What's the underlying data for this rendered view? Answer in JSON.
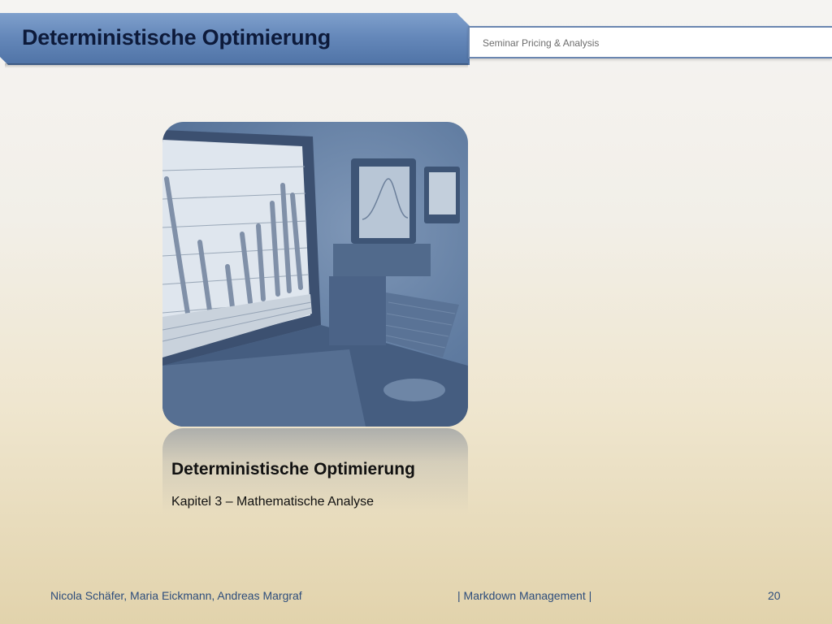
{
  "header": {
    "title": "Deterministische Optimierung",
    "subtitle": "Seminar Pricing & Analysis"
  },
  "card": {
    "image_alt": "computer-monitors-with-bar-chart-photo",
    "heading": "Deterministische Optimierung",
    "subheading": "Kapitel 3 – Mathematische Analyse"
  },
  "footer": {
    "authors": "Nicola Schäfer, Maria Eickmann, Andreas Margraf",
    "center": "|  Markdown Management  |",
    "page_number": "20"
  },
  "colors": {
    "banner_blue": "#6588ba",
    "title_text": "#0d1a3a",
    "footer_text": "#2d4d7c",
    "photo_tint": "#5f7ba0"
  }
}
